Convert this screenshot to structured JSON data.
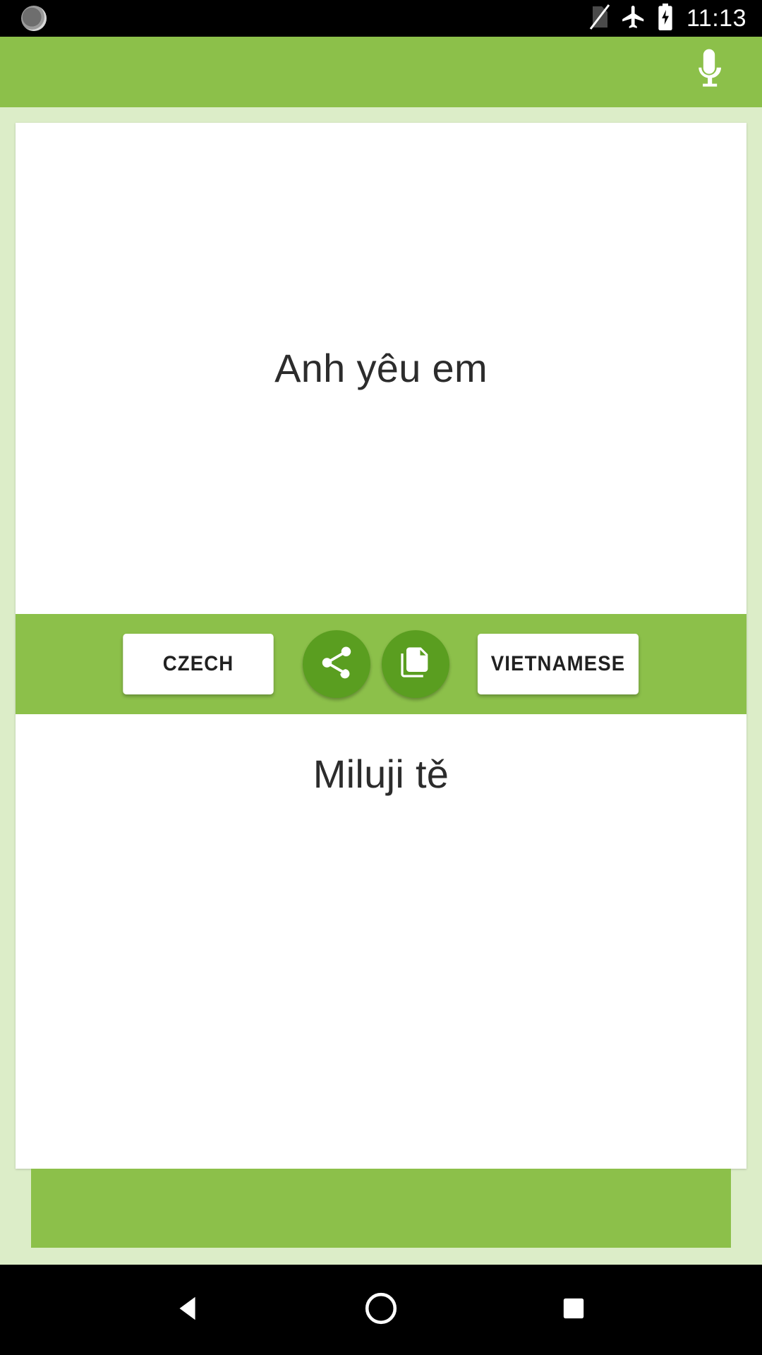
{
  "status_bar": {
    "time": "11:13",
    "icons": {
      "notification": "notification-circle-icon",
      "no_sim": "no-sim-icon",
      "airplane_mode": "airplane-mode-icon",
      "battery": "battery-charging-icon"
    },
    "background_color": "#000000",
    "foreground_color": "#ffffff"
  },
  "app_bar": {
    "mic_icon": "microphone-icon",
    "background_color": "#8cc04a"
  },
  "translator": {
    "source": {
      "text": "Anh yêu em",
      "language_label": "VIETNAMESE"
    },
    "target": {
      "text": "Miluji tě",
      "language_label": "CZECH"
    },
    "actions": {
      "share_icon": "share-icon",
      "copy_icon": "copy-icon"
    },
    "accent_color": "#8cc04a",
    "button_circle_color": "#5a9e20",
    "page_background": "#dcedc8",
    "text_color": "#2c2c2c"
  },
  "nav_bar": {
    "back": "back-triangle-icon",
    "home": "home-circle-icon",
    "recents": "recents-square-icon",
    "background_color": "#000000"
  }
}
